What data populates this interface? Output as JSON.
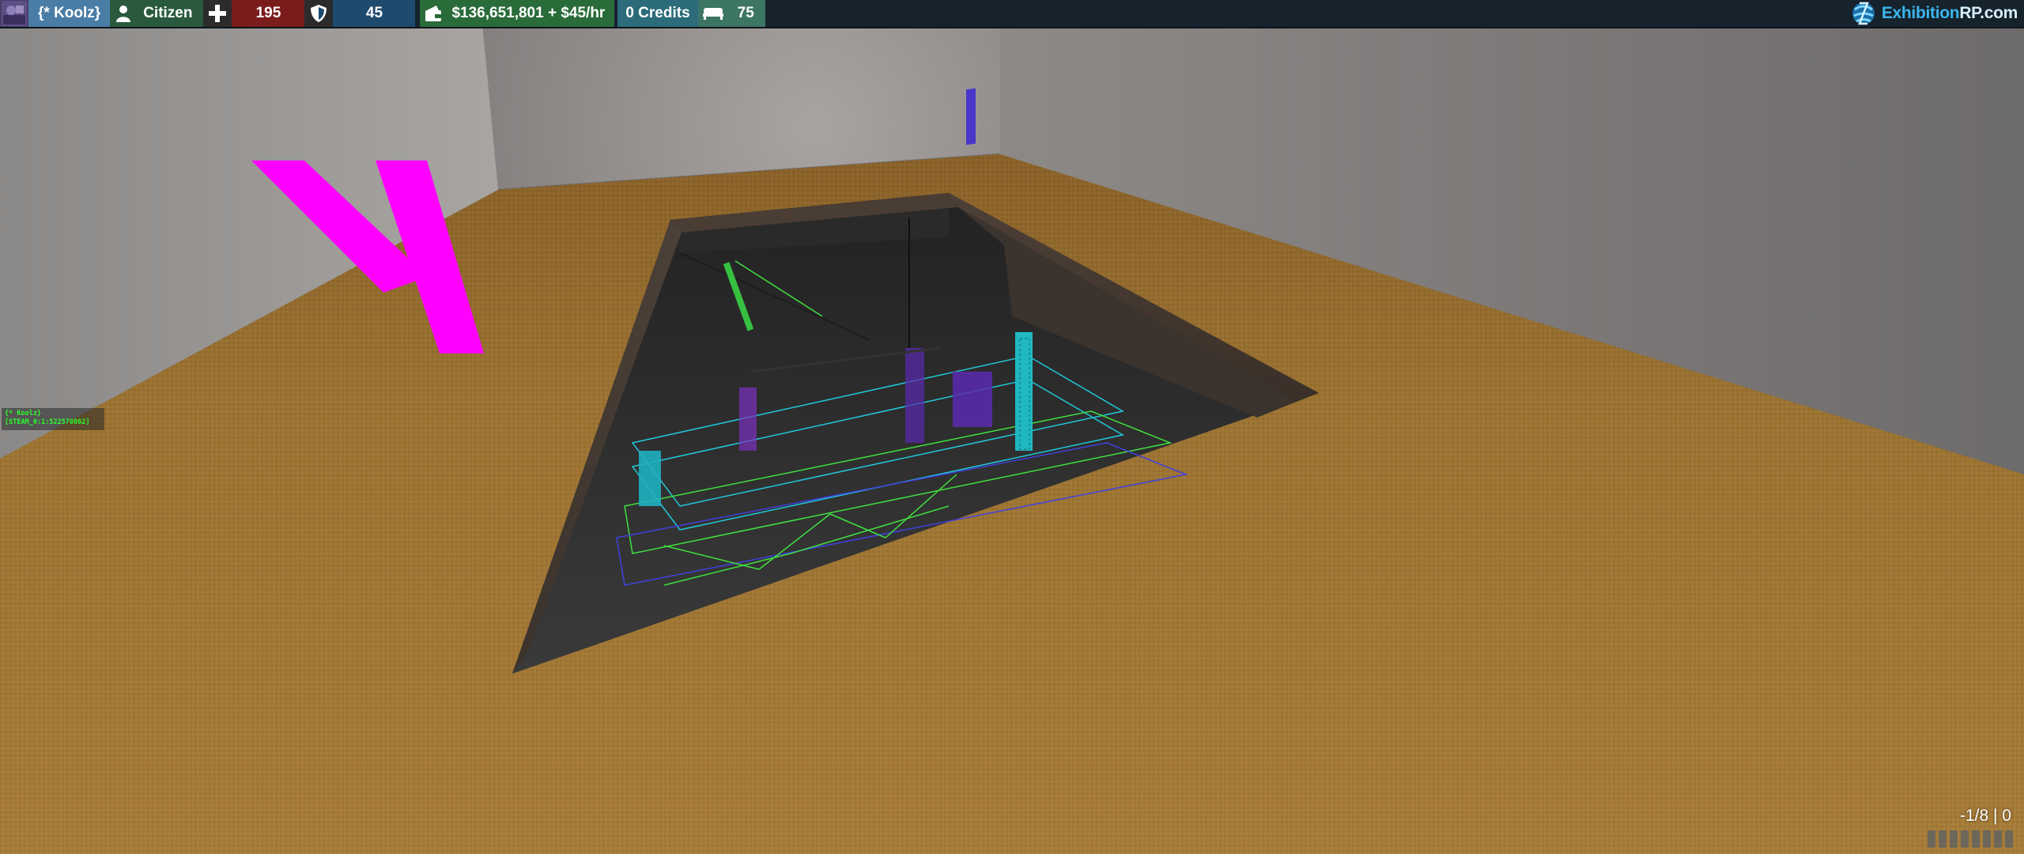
{
  "hud": {
    "player_name": "{* Koolz}",
    "job": "Citizen",
    "health": "195",
    "armor": "45",
    "money": "$136,651,801 + $45/hr",
    "credits": "0 Credits",
    "hunger": "75",
    "icons": {
      "avatar": "avatar-image",
      "job": "person-icon",
      "health": "plus-icon",
      "armor": "shield-icon",
      "money": "wallet-icon",
      "hunger": "bed-icon"
    },
    "colors": {
      "name_bg": "#4a7da6",
      "job_bg": "#2a5a3e",
      "health_bg": "#7b1c1c",
      "armor_bg": "#1e4a6e",
      "money_bg": "#2a6b3a",
      "credits_bg": "#2c6b7a",
      "hunger_bg": "#3d7565"
    }
  },
  "brand": {
    "name_part1": "Exhibition",
    "name_part2": "RP.com",
    "accent": "#3ab6ec"
  },
  "overhead_tag": {
    "name": "{* Koolz}",
    "steam_id": "[STEAM_0:1:522570862]",
    "color": "#2bff2b"
  },
  "ammo": {
    "readout": "-1/8 | 0",
    "reserve_bars": 8
  },
  "world": {
    "floor_color": "#9a7030",
    "wall_color": "#8e8c8c",
    "wireframe_colors": [
      "#20c8d8",
      "#40e040",
      "#4040e0",
      "#7a30c0"
    ],
    "marker_color": "#ff00ff"
  }
}
